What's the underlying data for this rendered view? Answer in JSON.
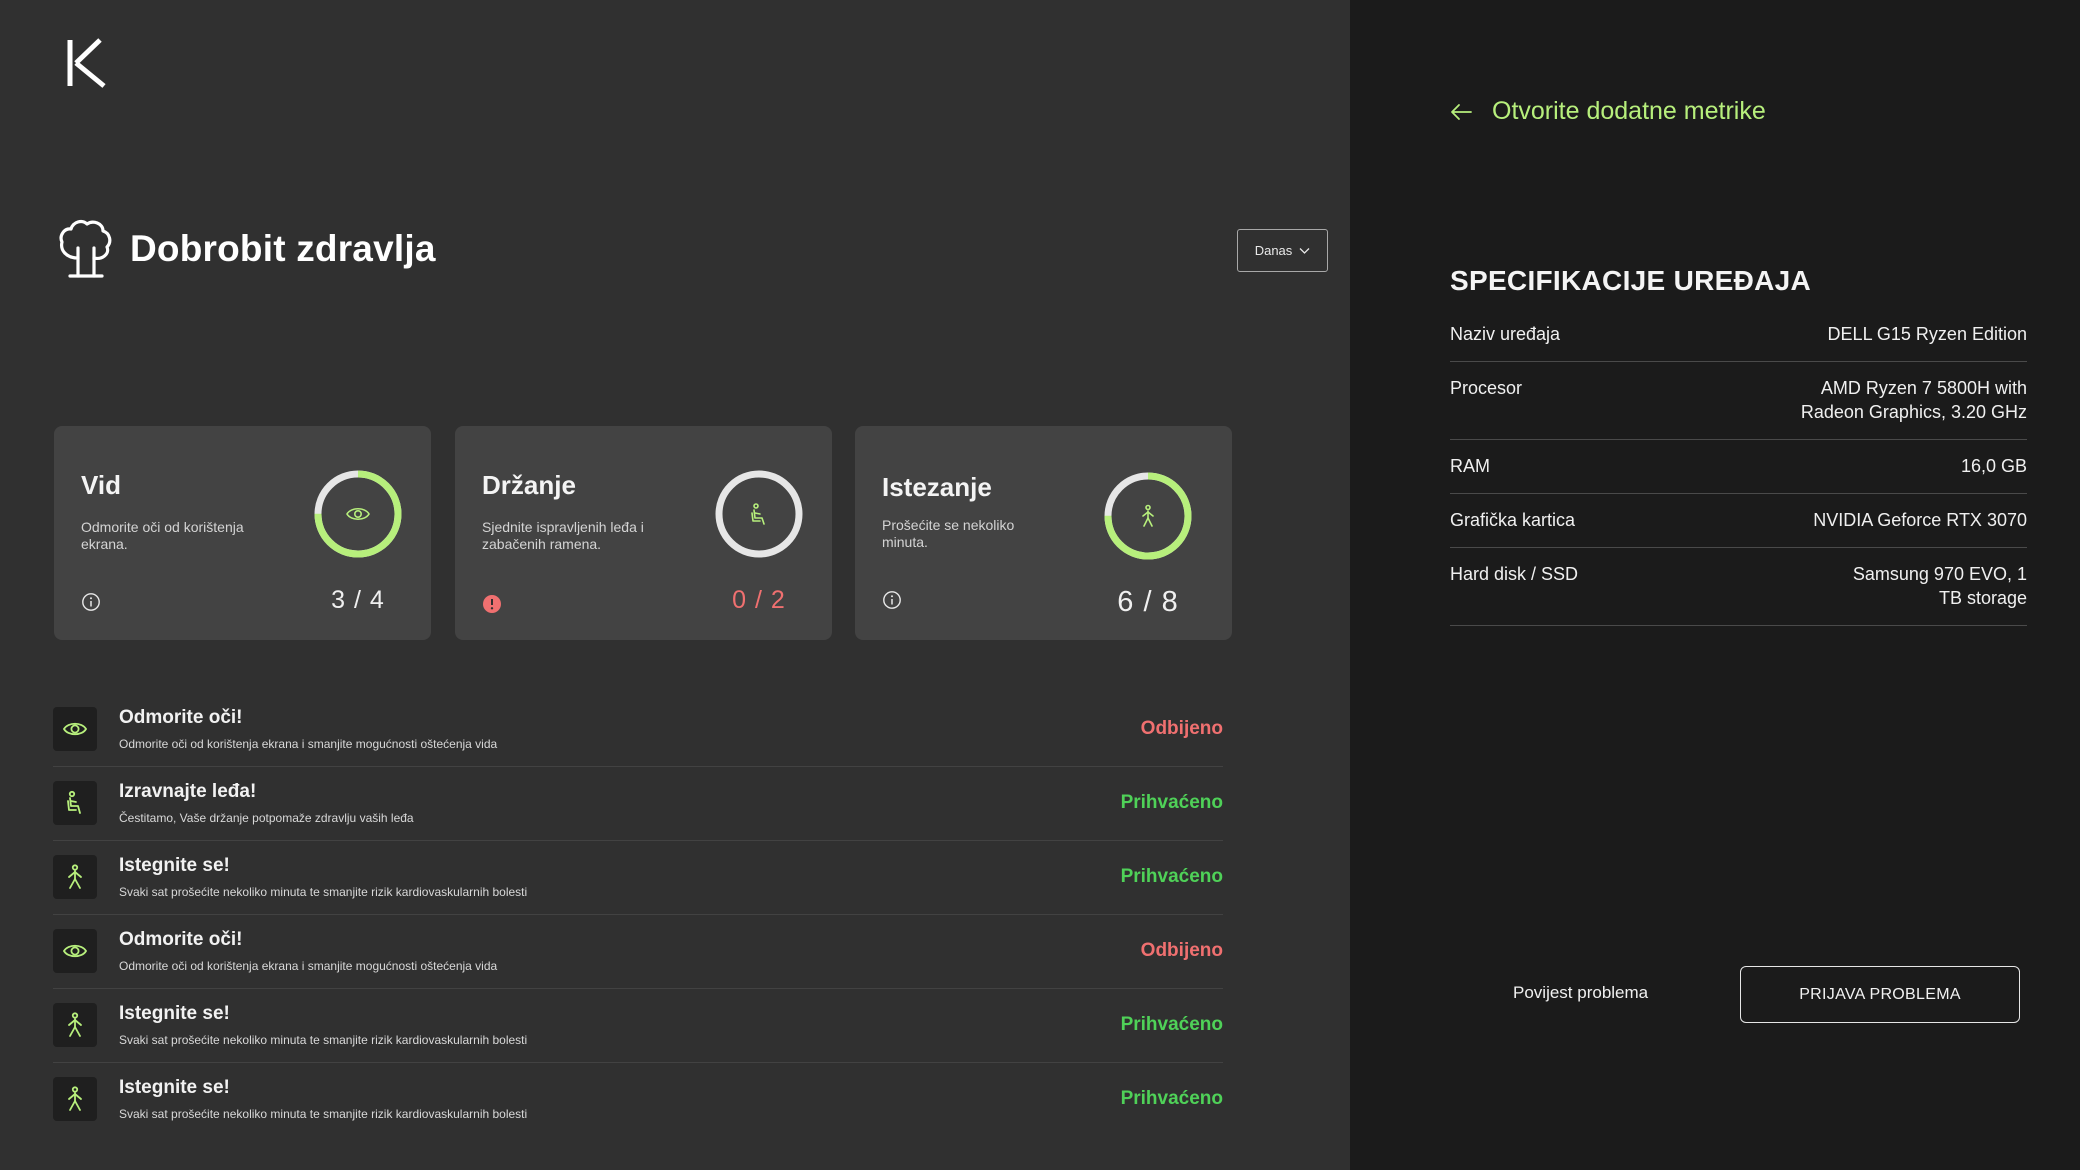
{
  "header": {
    "title": "Dobrobit zdravlja",
    "date_filter": "Danas"
  },
  "cards": [
    {
      "title": "Vid",
      "description": "Odmorite oči od korištenja ekrana.",
      "count": "3 / 4",
      "done": 3,
      "total": 4,
      "icon": "eye-icon",
      "status_icon": "info-icon"
    },
    {
      "title": "Držanje",
      "description": "Sjednite ispravljenih leđa i zabačenih ramena.",
      "count": "0 / 2",
      "done": 0,
      "total": 2,
      "icon": "posture-icon",
      "status_icon": "alert-icon"
    },
    {
      "title": "Istezanje",
      "description": "Prošećite se nekoliko minuta.",
      "count": "6 / 8",
      "done": 6,
      "total": 8,
      "icon": "walk-icon",
      "status_icon": "info-icon"
    }
  ],
  "notifications": [
    {
      "title": "Odmorite oči!",
      "description": "Odmorite oči od korištenja ekrana i smanjite mogućnosti oštećenja vida",
      "status": "Odbijeno",
      "icon": "eye-icon"
    },
    {
      "title": "Izravnajte leđa!",
      "description": "Čestitamo, Vaše držanje potpomaže zdravlju vaših leđa",
      "status": "Prihvaćeno",
      "icon": "posture-icon"
    },
    {
      "title": "Istegnite se!",
      "description": "Svaki sat prošećite nekoliko minuta te smanjite rizik kardiovaskularnih bolesti",
      "status": "Prihvaćeno",
      "icon": "walk-icon"
    },
    {
      "title": "Odmorite oči!",
      "description": "Odmorite oči od korištenja ekrana i smanjite mogućnosti oštećenja vida",
      "status": "Odbijeno",
      "icon": "eye-icon"
    },
    {
      "title": "Istegnite se!",
      "description": "Svaki sat prošećite nekoliko minuta te smanjite rizik kardiovaskularnih bolesti",
      "status": "Prihvaćeno",
      "icon": "walk-icon"
    },
    {
      "title": "Istegnite se!",
      "description": "Svaki sat prošećite nekoliko minuta te smanjite rizik kardiovaskularnih bolesti",
      "status": "Prihvaćeno",
      "icon": "walk-icon"
    }
  ],
  "sidebar": {
    "back_link": "Otvorite dodatne metrike",
    "spec_title": "SPECIFIKACIJE UREĐAJA",
    "specs": [
      {
        "label": "Naziv uređaja",
        "value": "DELL G15 Ryzen Edition"
      },
      {
        "label": "Procesor",
        "value": "AMD Ryzen 7 5800H with Radeon Graphics, 3.20 GHz"
      },
      {
        "label": "RAM",
        "value": "16,0 GB"
      },
      {
        "label": "Grafička kartica",
        "value": "NVIDIA Geforce RTX 3070"
      },
      {
        "label": "Hard disk / SSD",
        "value": "Samsung 970 EVO, 1 TB storage"
      }
    ],
    "history_link": "Povijest problema",
    "report_button": "PRIJAVA PROBLEMA"
  },
  "colors": {
    "accent_green": "#b7ef7c",
    "accepted": "#4fd158",
    "rejected": "#f07070"
  }
}
